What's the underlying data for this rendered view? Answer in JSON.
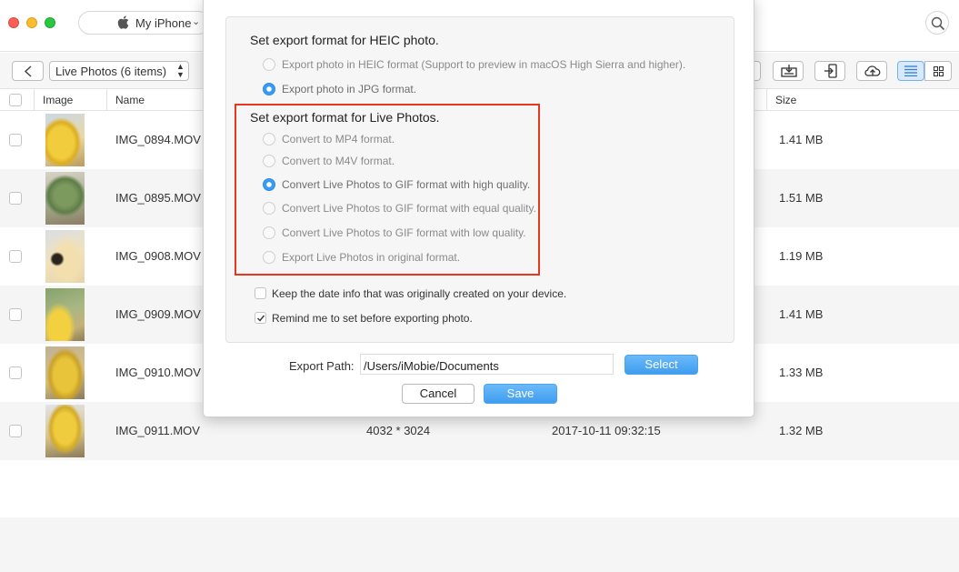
{
  "titlebar": {
    "device": "My iPhone",
    "icons": [
      "apple-icon",
      "chevron-down-icon",
      "search-icon"
    ]
  },
  "toolbar": {
    "album": "Live Photos (6 items)",
    "icons": [
      "back-arrow-icon",
      "export-to-computer-icon",
      "send-to-device-icon",
      "upload-cloud-icon",
      "list-view-icon",
      "grid-view-icon"
    ]
  },
  "table": {
    "headers": {
      "image": "Image",
      "name": "Name",
      "size": "Size"
    },
    "rows": [
      {
        "name": "IMG_0894.MOV",
        "dimensions": "",
        "date": "",
        "size": "1.41 MB"
      },
      {
        "name": "IMG_0895.MOV",
        "dimensions": "",
        "date": "",
        "size": "1.51 MB"
      },
      {
        "name": "IMG_0908.MOV",
        "dimensions": "",
        "date": "",
        "size": "1.19 MB"
      },
      {
        "name": "IMG_0909.MOV",
        "dimensions": "",
        "date": "",
        "size": "1.41 MB"
      },
      {
        "name": "IMG_0910.MOV",
        "dimensions": "",
        "date": "",
        "size": "1.33 MB"
      },
      {
        "name": "IMG_0911.MOV",
        "dimensions": "4032 * 3024",
        "date": "2017-10-11 09:32:15",
        "size": "1.32 MB"
      }
    ]
  },
  "dialog": {
    "heic_title": "Set export format for HEIC photo.",
    "heic_options": [
      {
        "label": "Export photo in HEIC format (Support to preview in macOS High Sierra and higher).",
        "selected": false
      },
      {
        "label": "Export photo in JPG format.",
        "selected": true
      }
    ],
    "live_title": "Set export format for Live Photos.",
    "live_options": [
      {
        "label": "Convert to MP4 format.",
        "selected": false
      },
      {
        "label": "Convert to M4V format.",
        "selected": false
      },
      {
        "label": "Convert Live Photos to GIF format with high quality.",
        "selected": true
      },
      {
        "label": "Convert Live Photos to GIF format with equal quality.",
        "selected": false
      },
      {
        "label": "Convert Live Photos to GIF format with low quality.",
        "selected": false
      },
      {
        "label": "Export Live Photos in original format.",
        "selected": false
      }
    ],
    "checkboxes": [
      {
        "label": "Keep the date info that was originally created on your device.",
        "checked": false
      },
      {
        "label": "Remind me to set before exporting photo.",
        "checked": true
      }
    ],
    "export_path_label": "Export Path:",
    "export_path_value": "/Users/iMobie/Documents",
    "select_label": "Select",
    "cancel_label": "Cancel",
    "save_label": "Save",
    "colors": {
      "accent": "#3a9bf0",
      "highlight": "#e5391f"
    }
  }
}
